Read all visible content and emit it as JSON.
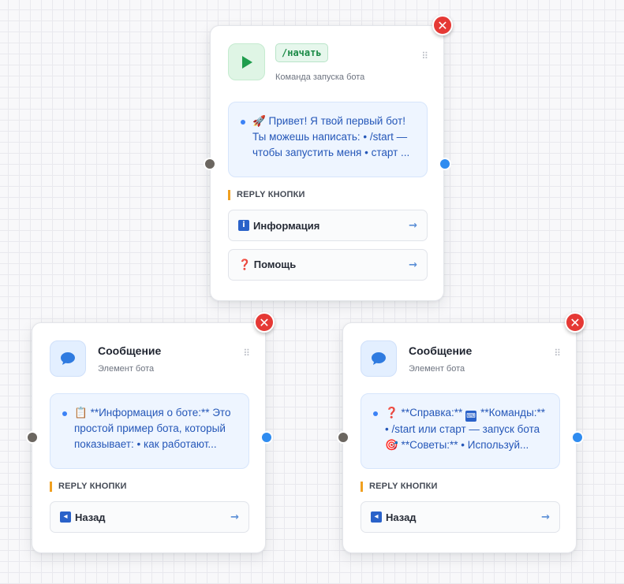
{
  "start_node": {
    "command": "/начать",
    "subtitle": "Команда запуска бота",
    "message_line1": "🚀 Привет! Я твой первый бот!",
    "message_line2": "Ты можешь написать: • /start —",
    "message_line3": "чтобы запустить меня • старт ...",
    "section_label": "REPLY КНОПКИ",
    "buttons": [
      {
        "icon": "info-icon",
        "label": "Информация"
      },
      {
        "icon": "question-icon",
        "label": "❓ Помощь"
      }
    ]
  },
  "info_node": {
    "title": "Сообщение",
    "subtitle": "Элемент бота",
    "message_line1": "**Информация о боте:** Это",
    "message_line2": "простой пример бота, который",
    "message_line3": "показывает: • как работают...",
    "section_label": "REPLY КНОПКИ",
    "buttons": [
      {
        "icon": "back-icon",
        "label": "Назад"
      }
    ]
  },
  "help_node": {
    "title": "Сообщение",
    "subtitle": "Элемент бота",
    "message_line1a": "❓ **Справка:**",
    "message_line1b": "**Команды:**",
    "message_line2": "• /start или старт — запуск бота",
    "message_line3": "🎯 **Советы:** • Используй...",
    "section_label": "REPLY КНОПКИ",
    "buttons": [
      {
        "icon": "back-icon",
        "label": "Назад"
      }
    ]
  },
  "colors": {
    "close": "#e53935",
    "port_out": "#2f8cf0",
    "port_in": "#6b6660",
    "accent_label": "#f0a020",
    "message_text": "#2557b8"
  }
}
